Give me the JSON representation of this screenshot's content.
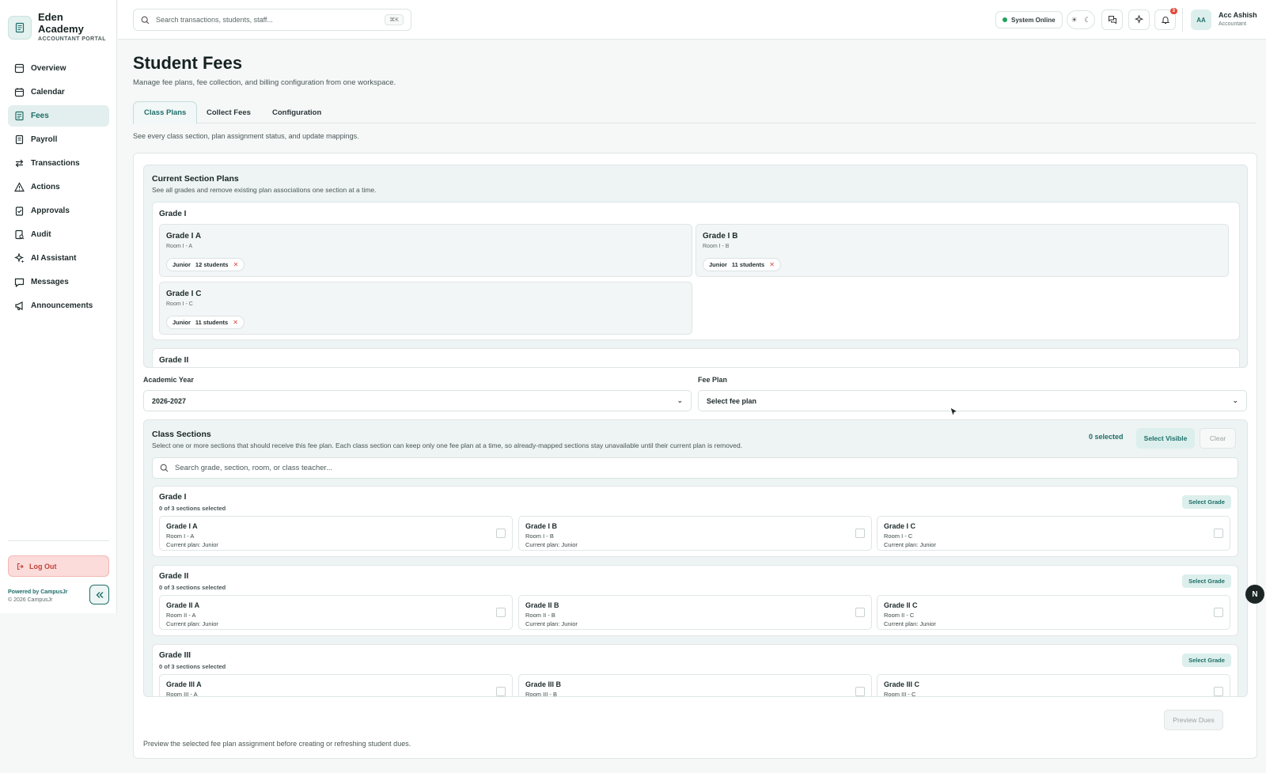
{
  "brand": {
    "name_line1": "Eden",
    "name_line2": "Academy",
    "subtitle": "ACCOUNTANT PORTAL",
    "icon": "receipt-icon"
  },
  "nav": [
    {
      "label": "Overview",
      "icon": "overview-icon"
    },
    {
      "label": "Calendar",
      "icon": "calendar-icon"
    },
    {
      "label": "Fees",
      "icon": "fees-icon",
      "active": true
    },
    {
      "label": "Payroll",
      "icon": "payroll-icon"
    },
    {
      "label": "Transactions",
      "icon": "transactions-icon"
    },
    {
      "label": "Actions",
      "icon": "warning-icon"
    },
    {
      "label": "Approvals",
      "icon": "clipboard-check-icon"
    },
    {
      "label": "Audit",
      "icon": "audit-icon"
    },
    {
      "label": "AI Assistant",
      "icon": "sparkle-icon"
    },
    {
      "label": "Messages",
      "icon": "message-icon"
    },
    {
      "label": "Announcements",
      "icon": "megaphone-icon"
    }
  ],
  "logout_label": "Log Out",
  "powered_by": "Powered by CampusJr",
  "copyright": "© 2026 CampusJr",
  "search": {
    "placeholder": "Search transactions, students, staff...",
    "shortcut": "⌘K"
  },
  "status": {
    "label": "System Online",
    "color": "#1ea25a"
  },
  "notifications": {
    "count": "3"
  },
  "user": {
    "initials": "AA",
    "name": "Acc Ashish",
    "role": "Accountant"
  },
  "page": {
    "title": "Student Fees",
    "subtitle": "Manage fee plans, fee collection, and billing configuration from one workspace.",
    "tabs": [
      "Class Plans",
      "Collect Fees",
      "Configuration"
    ],
    "tab_desc": "See every class section, plan assignment status, and update mappings."
  },
  "current_plans": {
    "title": "Current Section Plans",
    "desc": "See all grades and remove existing plan associations one section at a time.",
    "grade": "Grade I",
    "next_grade": "Grade II",
    "cards": [
      {
        "name": "Grade I A",
        "room": "Room I - A",
        "plan": "Junior",
        "students": "12 students"
      },
      {
        "name": "Grade I B",
        "room": "Room I - B",
        "plan": "Junior",
        "students": "11 students"
      },
      {
        "name": "Grade I C",
        "room": "Room I - C",
        "plan": "Junior",
        "students": "11 students"
      }
    ]
  },
  "form": {
    "year_label": "Academic Year",
    "year_value": "2026-2027",
    "plan_label": "Fee Plan",
    "plan_value": "Select fee plan"
  },
  "class_sections": {
    "title": "Class Sections",
    "desc": "Select one or more sections that should receive this fee plan. Each class section can keep only one fee plan at a time, so already-mapped sections stay unavailable until their current plan is removed.",
    "selected": "0 selected",
    "select_visible": "Select Visible",
    "clear": "Clear",
    "search_placeholder": "Search grade, section, room, or class teacher...",
    "select_grade": "Select Grade",
    "grades": [
      {
        "name": "Grade I",
        "summary": "0 of 3 sections selected",
        "sections": [
          {
            "name": "Grade I A",
            "room": "Room I - A",
            "plan": "Current plan: Junior"
          },
          {
            "name": "Grade I B",
            "room": "Room I - B",
            "plan": "Current plan: Junior"
          },
          {
            "name": "Grade I C",
            "room": "Room I - C",
            "plan": "Current plan: Junior"
          }
        ]
      },
      {
        "name": "Grade II",
        "summary": "0 of 3 sections selected",
        "sections": [
          {
            "name": "Grade II A",
            "room": "Room II - A",
            "plan": "Current plan: Junior"
          },
          {
            "name": "Grade II B",
            "room": "Room II - B",
            "plan": "Current plan: Junior"
          },
          {
            "name": "Grade II C",
            "room": "Room II - C",
            "plan": "Current plan: Junior"
          }
        ]
      },
      {
        "name": "Grade III",
        "summary": "0 of 3 sections selected",
        "sections": [
          {
            "name": "Grade III A",
            "room": "Room III - A",
            "plan": ""
          },
          {
            "name": "Grade III B",
            "room": "Room III - B",
            "plan": ""
          },
          {
            "name": "Grade III C",
            "room": "Room III - C",
            "plan": ""
          }
        ]
      }
    ]
  },
  "preview": {
    "button": "Preview Dues",
    "desc": "Preview the selected fee plan assignment before creating or refreshing student dues."
  },
  "fab_label": "N",
  "colors": {
    "accent": "#1e6e68",
    "danger": "#d5493d"
  }
}
